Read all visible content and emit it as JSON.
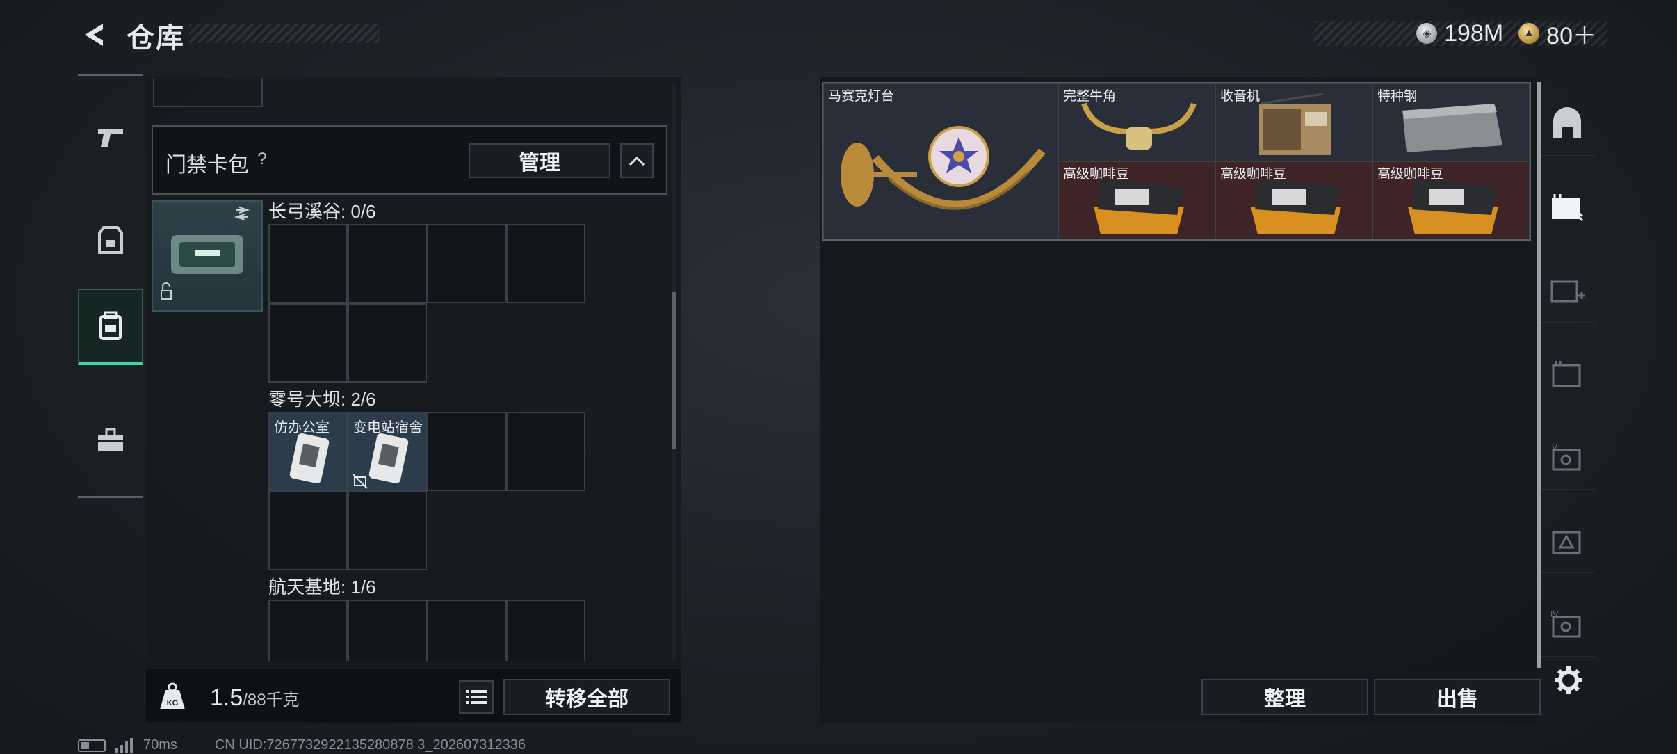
{
  "header": {
    "title": "仓库",
    "currencies": [
      {
        "icon": "silver-coin-icon",
        "value": "198M"
      },
      {
        "icon": "gold-coin-icon",
        "value": "80＋"
      }
    ]
  },
  "left_nav": {
    "items": [
      {
        "icon": "pistol-icon",
        "active": false
      },
      {
        "icon": "armor-vest-icon",
        "active": false
      },
      {
        "icon": "backpack-icon",
        "active": true
      },
      {
        "icon": "toolbox-icon",
        "active": false
      }
    ]
  },
  "card_pack": {
    "title": "门禁卡包",
    "help": "?",
    "manage_label": "管理",
    "weight_current": "1.5",
    "weight_max": "/88千克",
    "transfer_all_label": "转移全部"
  },
  "sections": [
    {
      "label": "长弓溪谷: 0/6",
      "slots": [
        {
          "name": ""
        },
        {
          "name": ""
        },
        {
          "name": ""
        },
        {
          "name": ""
        },
        {
          "name": ""
        },
        {
          "name": ""
        }
      ]
    },
    {
      "label": "零号大坝: 2/6",
      "slots": [
        {
          "name": "仿办公室"
        },
        {
          "name": "变电站宿舍"
        },
        {
          "name": ""
        },
        {
          "name": ""
        },
        {
          "name": ""
        },
        {
          "name": ""
        }
      ]
    },
    {
      "label": "航天基地: 1/6",
      "slots": [
        {
          "name": ""
        },
        {
          "name": ""
        },
        {
          "name": ""
        },
        {
          "name": ""
        }
      ]
    }
  ],
  "storage_items": [
    {
      "name": "马赛克灯台",
      "rarity_color": "#2a2e38"
    },
    {
      "name": "完整牛角",
      "rarity_color": "#2a2e38"
    },
    {
      "name": "收音机",
      "rarity_color": "#2a2e38"
    },
    {
      "name": "特种钢",
      "rarity_color": "#2a2e38"
    },
    {
      "name": "高级咖啡豆",
      "rarity_color": "#3e2427"
    },
    {
      "name": "高级咖啡豆",
      "rarity_color": "#3e2427"
    },
    {
      "name": "高级咖啡豆",
      "rarity_color": "#3e2427"
    }
  ],
  "right_actions": {
    "sort_label": "整理",
    "sell_label": "出售"
  },
  "right_nav": {
    "items": [
      "vault-icon",
      "stash-tab-icon",
      "add-stash-icon",
      "stash-2-icon",
      "stash-V-icon",
      "stash-tri-icon",
      "stash-IV-icon"
    ]
  },
  "status": {
    "ping": "70ms",
    "uid": "CN UID:7267732922135280878 3_202607312336"
  },
  "colors": {
    "accent": "#3fd6a8",
    "rare_red": "#3e2427",
    "item_dark": "#2a2e38"
  }
}
